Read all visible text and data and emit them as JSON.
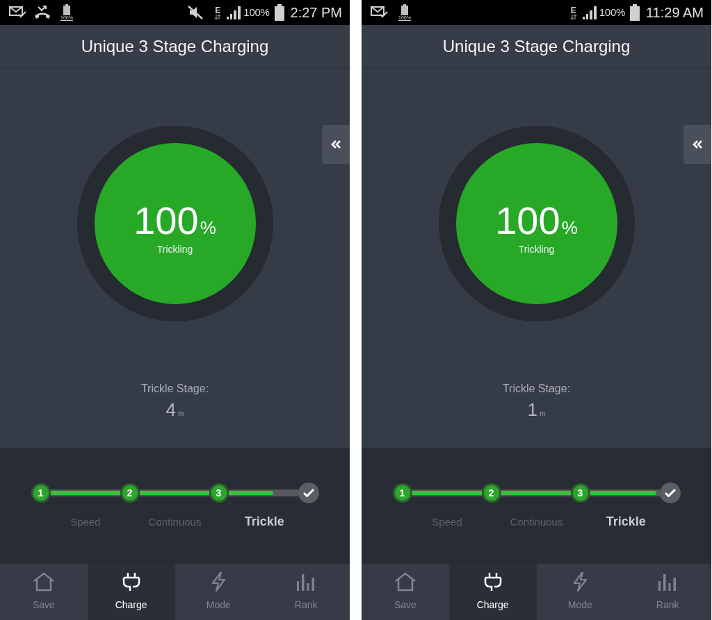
{
  "screens": [
    {
      "status_bar": {
        "notifications": [
          {
            "kind": "mail"
          },
          {
            "kind": "missed_call"
          },
          {
            "kind": "battery",
            "label": "100%"
          }
        ],
        "muted": true,
        "network": "E",
        "battery": "100%",
        "time": "2:27 PM"
      },
      "title": "Unique 3 Stage Charging",
      "gauge": {
        "value": "100",
        "unit": "%",
        "status": "Trickling"
      },
      "stage": {
        "label": "Trickle Stage:",
        "value": "4",
        "unit": "m"
      },
      "stepper": {
        "level": 0.64,
        "steps": [
          {
            "number": "1",
            "label": "Speed",
            "done": true,
            "selected": false
          },
          {
            "number": "2",
            "label": "Continuous",
            "done": true,
            "selected": false
          },
          {
            "number": "3",
            "label": "Trickle",
            "done": true,
            "selected": true
          }
        ]
      },
      "nav": [
        {
          "label": "Save",
          "selected": false
        },
        {
          "label": "Charge",
          "selected": true
        },
        {
          "label": "Mode",
          "selected": false
        },
        {
          "label": "Rank",
          "selected": false
        }
      ]
    },
    {
      "status_bar": {
        "notifications": [
          {
            "kind": "mail"
          },
          {
            "kind": "battery",
            "label": "100%"
          }
        ],
        "muted": false,
        "network": "E",
        "battery": "100%",
        "time": "11:29 AM"
      },
      "title": "Unique 3 Stage Charging",
      "gauge": {
        "value": "100",
        "unit": "%",
        "status": "Trickling"
      },
      "stage": {
        "label": "Trickle Stage:",
        "value": "1",
        "unit": "m"
      },
      "stepper": {
        "level": 0.95,
        "steps": [
          {
            "number": "1",
            "label": "Speed",
            "done": true,
            "selected": false
          },
          {
            "number": "2",
            "label": "Continuous",
            "done": true,
            "selected": false
          },
          {
            "number": "3",
            "label": "Trickle",
            "done": true,
            "selected": true
          }
        ]
      },
      "nav": [
        {
          "label": "Save",
          "selected": false
        },
        {
          "label": "Charge",
          "selected": true
        },
        {
          "label": "Mode",
          "selected": false
        },
        {
          "label": "Rank",
          "selected": false
        }
      ]
    }
  ]
}
